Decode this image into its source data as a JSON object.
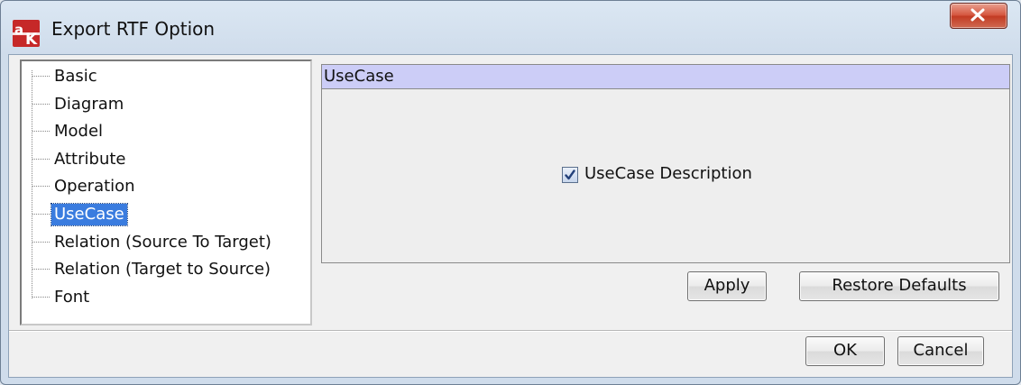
{
  "window": {
    "title": "Export RTF Option",
    "icon": "app-logo-icon",
    "close_icon": "close-icon"
  },
  "tree": {
    "items": [
      {
        "label": "Basic",
        "selected": false
      },
      {
        "label": "Diagram",
        "selected": false
      },
      {
        "label": "Model",
        "selected": false
      },
      {
        "label": "Attribute",
        "selected": false
      },
      {
        "label": "Operation",
        "selected": false
      },
      {
        "label": "UseCase",
        "selected": true
      },
      {
        "label": "Relation (Source To Target)",
        "selected": false
      },
      {
        "label": "Relation (Target to Source)",
        "selected": false
      },
      {
        "label": "Font",
        "selected": false
      }
    ]
  },
  "panel": {
    "header": "UseCase",
    "checkbox": {
      "label": "UseCase Description",
      "checked": true
    },
    "apply_label": "Apply",
    "restore_label": "Restore Defaults"
  },
  "footer": {
    "ok_label": "OK",
    "cancel_label": "Cancel"
  },
  "colors": {
    "selection": "#3a7cdf",
    "panel_header": "#cccdf7",
    "close_button": "#c94b33"
  }
}
